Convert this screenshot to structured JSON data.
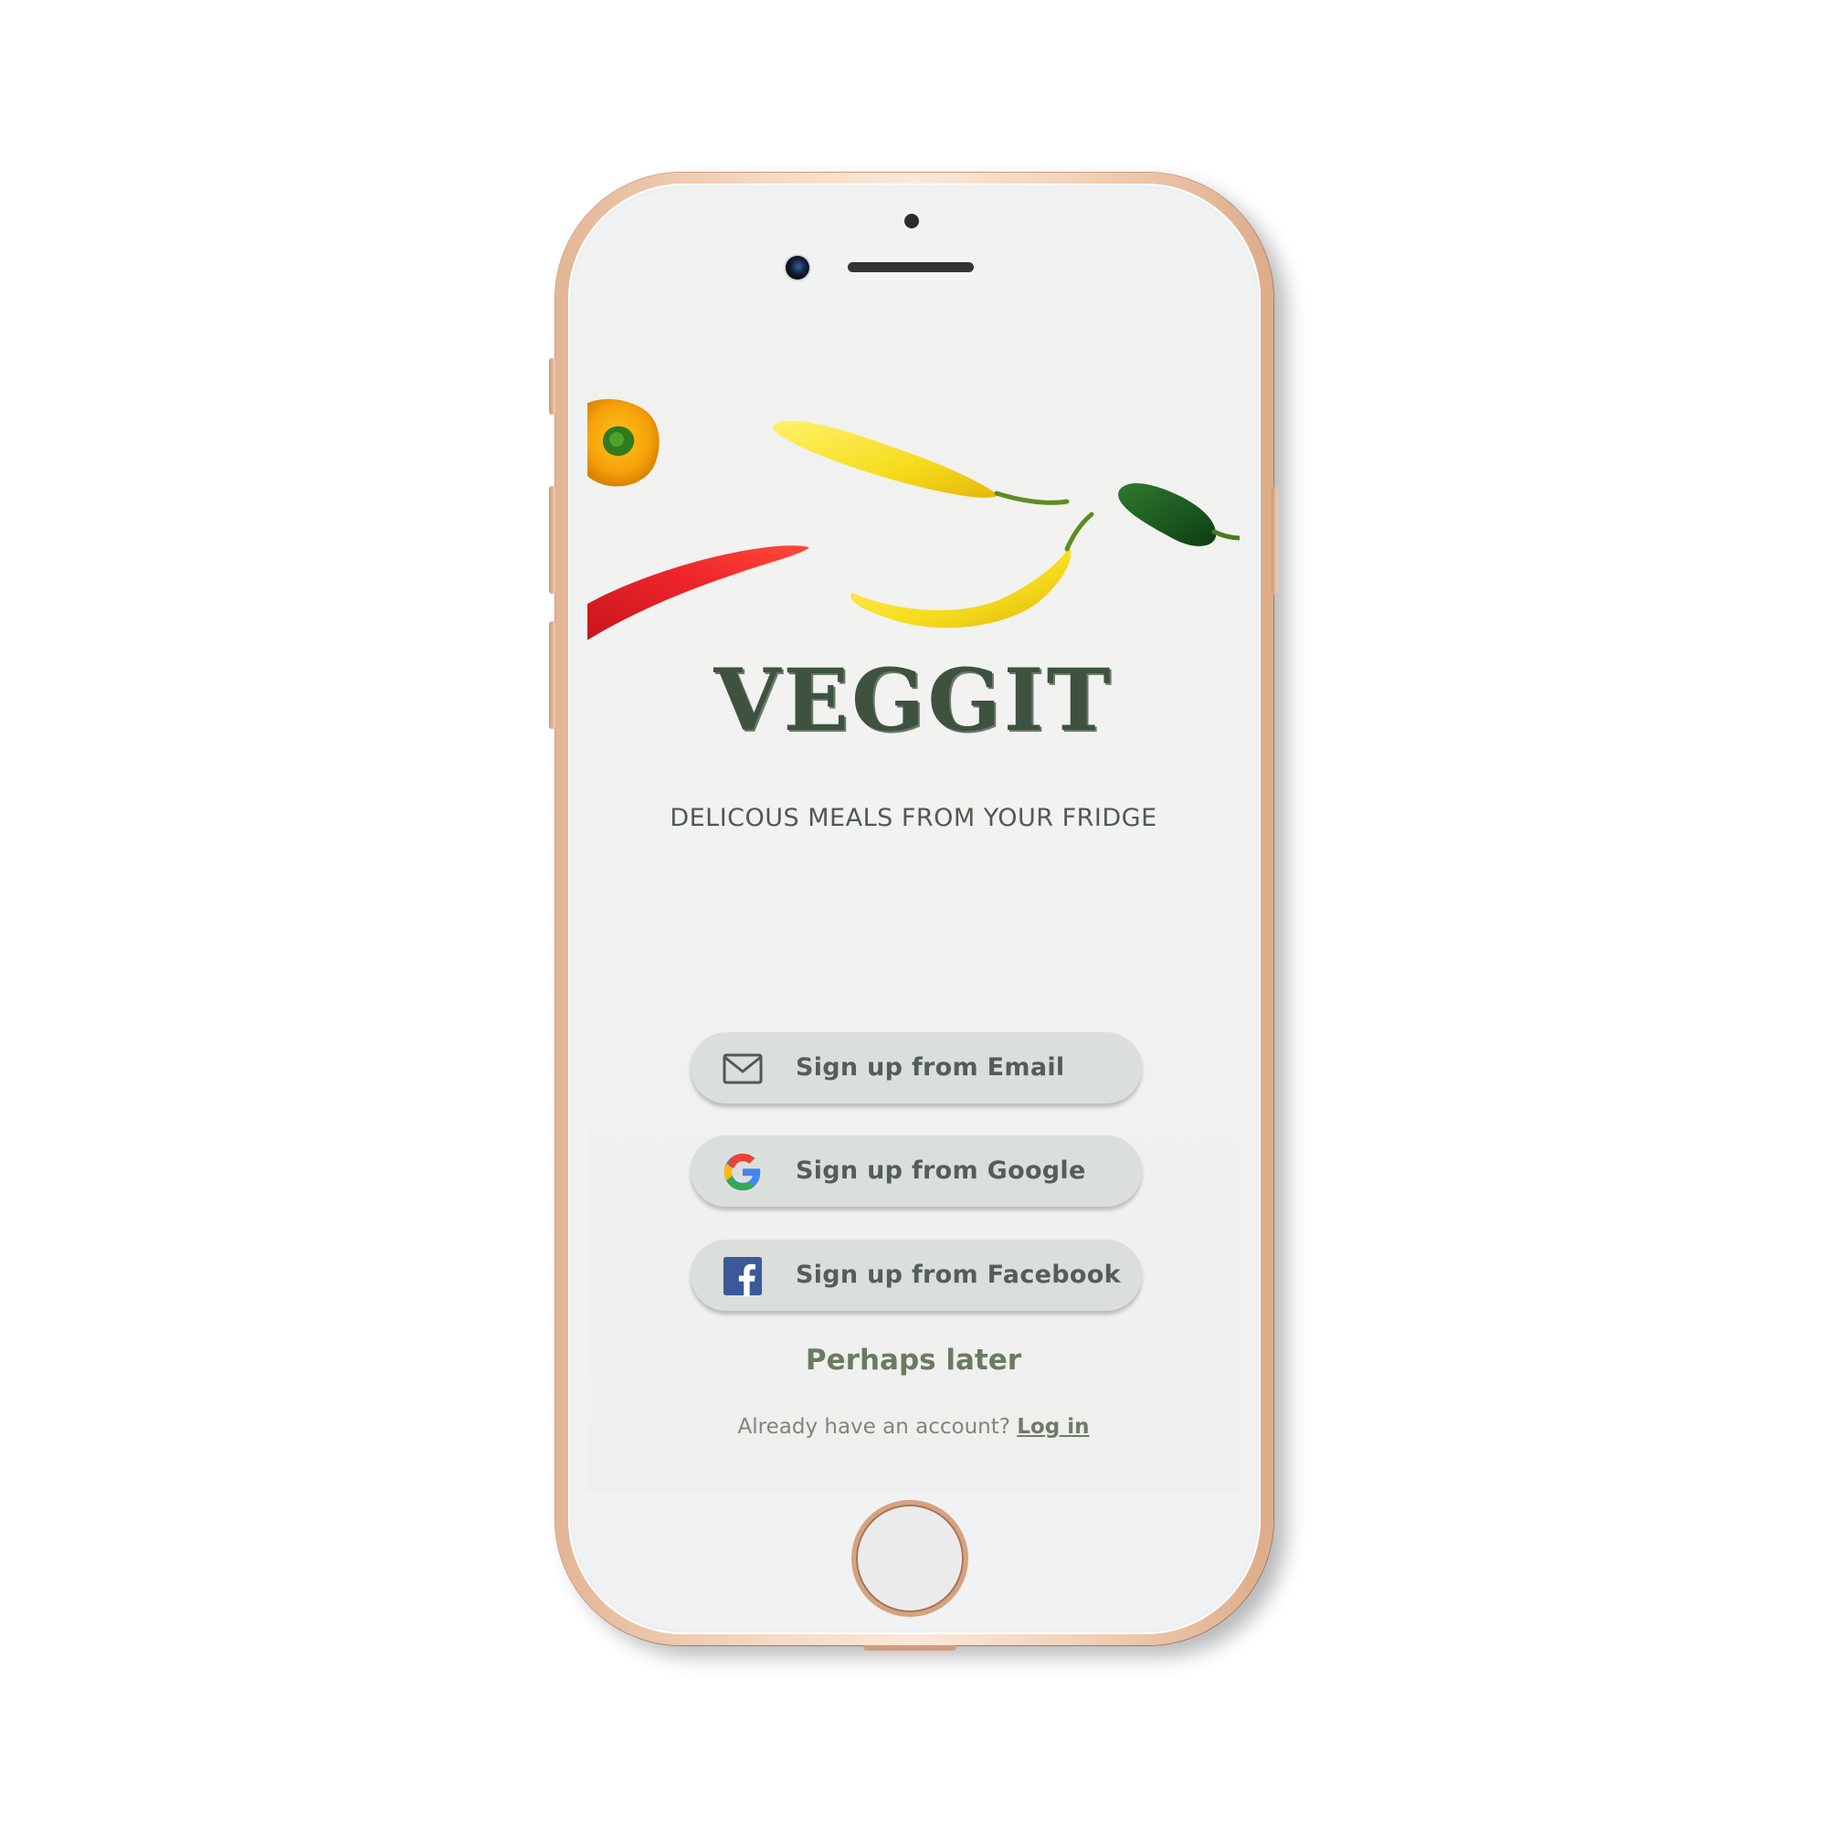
{
  "app": {
    "logo": "VEGGIT",
    "tagline": "DELICOUS MEALS FROM YOUR FRIDGE"
  },
  "auth": {
    "email_label": "Sign up from Email",
    "google_label": "Sign up from Google",
    "facebook_label": "Sign up from Facebook",
    "skip_label": "Perhaps later",
    "login_prompt": "Already have an account?",
    "login_link": "Log in"
  },
  "icons": {
    "email": "envelope-icon",
    "google": "google-logo-icon",
    "facebook": "facebook-logo-icon"
  },
  "colors": {
    "brand_green": "#3f5240",
    "button_bg": "#dadfdb",
    "button_text": "#535e56",
    "link_green": "#6c7a62",
    "phone_frame": "#f3d3bb"
  }
}
